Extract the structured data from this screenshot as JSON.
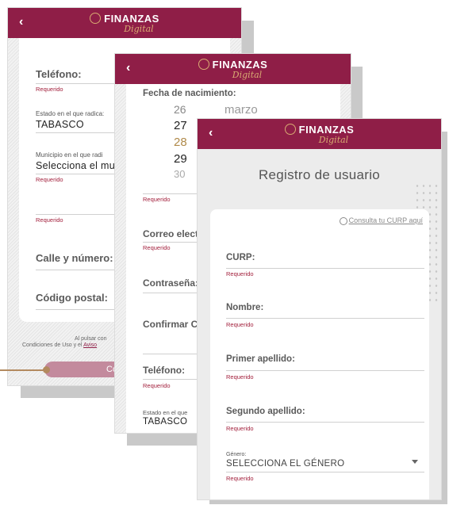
{
  "brand": {
    "name": "FINANZAS",
    "script": "Digital"
  },
  "icons": {
    "back": "back-arrow-icon",
    "logo": "finanzas-logo-icon",
    "curp_link": "search-icon"
  },
  "colors": {
    "header": "#8f1e47",
    "accent_gold": "#d8aa72",
    "required": "#a3213d"
  },
  "screen1": {
    "telefono_label": "Teléfono:",
    "telefono_required": "Requerido",
    "estado_label": "Estado en el que radica:",
    "estado_value": "TABASCO",
    "municipio_label": "Municipio en el que radi",
    "municipio_value": "Selecciona el mun",
    "municipio_required": "Requerido",
    "extra_required": "Requerido",
    "calle_label": "Calle y número:",
    "cp_label": "Código postal:",
    "terms_line1": "Al pulsar con",
    "terms_line2": "Condiciones de Uso y el",
    "terms_link": "Aviso",
    "continue_label": "Co"
  },
  "screen2": {
    "fecha_label": "Fecha de nacimiento:",
    "days": [
      "26",
      "27",
      "28",
      "29",
      "30"
    ],
    "month": "marzo",
    "fecha_required": "Requerido",
    "correo_label": "Correo electr",
    "correo_required": "Requerido",
    "password_label": "Contraseña:",
    "confirm_label": "Confirmar C",
    "telefono_label": "Teléfono:",
    "telefono_required": "Requerido",
    "estado_label": "Estado en el que",
    "estado_value": "TABASCO"
  },
  "screen3": {
    "title": "Registro de usuario",
    "curp_link": "Consulta tu CURP aquí",
    "fields": [
      {
        "label": "CURP:",
        "required": "Requerido"
      },
      {
        "label": "Nombre:",
        "required": "Requerido"
      },
      {
        "label": "Primer apellido:",
        "required": "Requerido"
      },
      {
        "label": "Segundo apellido:",
        "required": "Requerido"
      }
    ],
    "genero_label": "Género:",
    "genero_value": "SELECCIONA EL GÉNERO",
    "genero_required": "Requerido"
  }
}
